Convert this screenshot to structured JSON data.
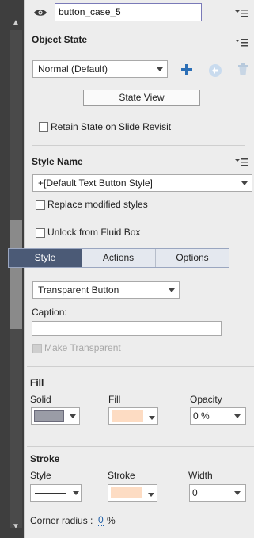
{
  "object_name": "button_case_5",
  "object_state": {
    "title": "Object State",
    "state_select": "Normal (Default)",
    "state_view_button": "State View",
    "retain_state_label": "Retain State on Slide Revisit"
  },
  "style": {
    "title": "Style Name",
    "style_select": "+[Default Text Button Style]",
    "replace_modified_label": "Replace modified styles",
    "unlock_fluid_box_label": "Unlock from Fluid Box"
  },
  "tabs": [
    {
      "label": "Style",
      "active": true
    },
    {
      "label": "Actions",
      "active": false
    },
    {
      "label": "Options",
      "active": false
    }
  ],
  "button_type": "Transparent Button",
  "caption_label": "Caption:",
  "caption_value": "",
  "make_transparent_label": "Make Transparent",
  "fill": {
    "title": "Fill",
    "solid_label": "Solid",
    "fill_label": "Fill",
    "opacity_label": "Opacity",
    "opacity_value": "0 %",
    "solid_color": "#9a9ca6",
    "fill_color": "#fddcc3"
  },
  "stroke": {
    "title": "Stroke",
    "style_label": "Style",
    "stroke_label": "Stroke",
    "width_label": "Width",
    "width_value": "0",
    "stroke_color": "#fddcc3"
  },
  "corner_radius_label": "Corner radius :",
  "corner_radius_value": "0",
  "corner_radius_unit": "%",
  "icons": {
    "visibility": "eye-icon",
    "menu": "panel-menu-icon",
    "add": "plus-icon",
    "reset": "reset-state-icon",
    "delete": "trash-icon"
  },
  "colors": {
    "accent_blue": "#2c6fb6",
    "tab_active_bg": "#4b5a76"
  }
}
